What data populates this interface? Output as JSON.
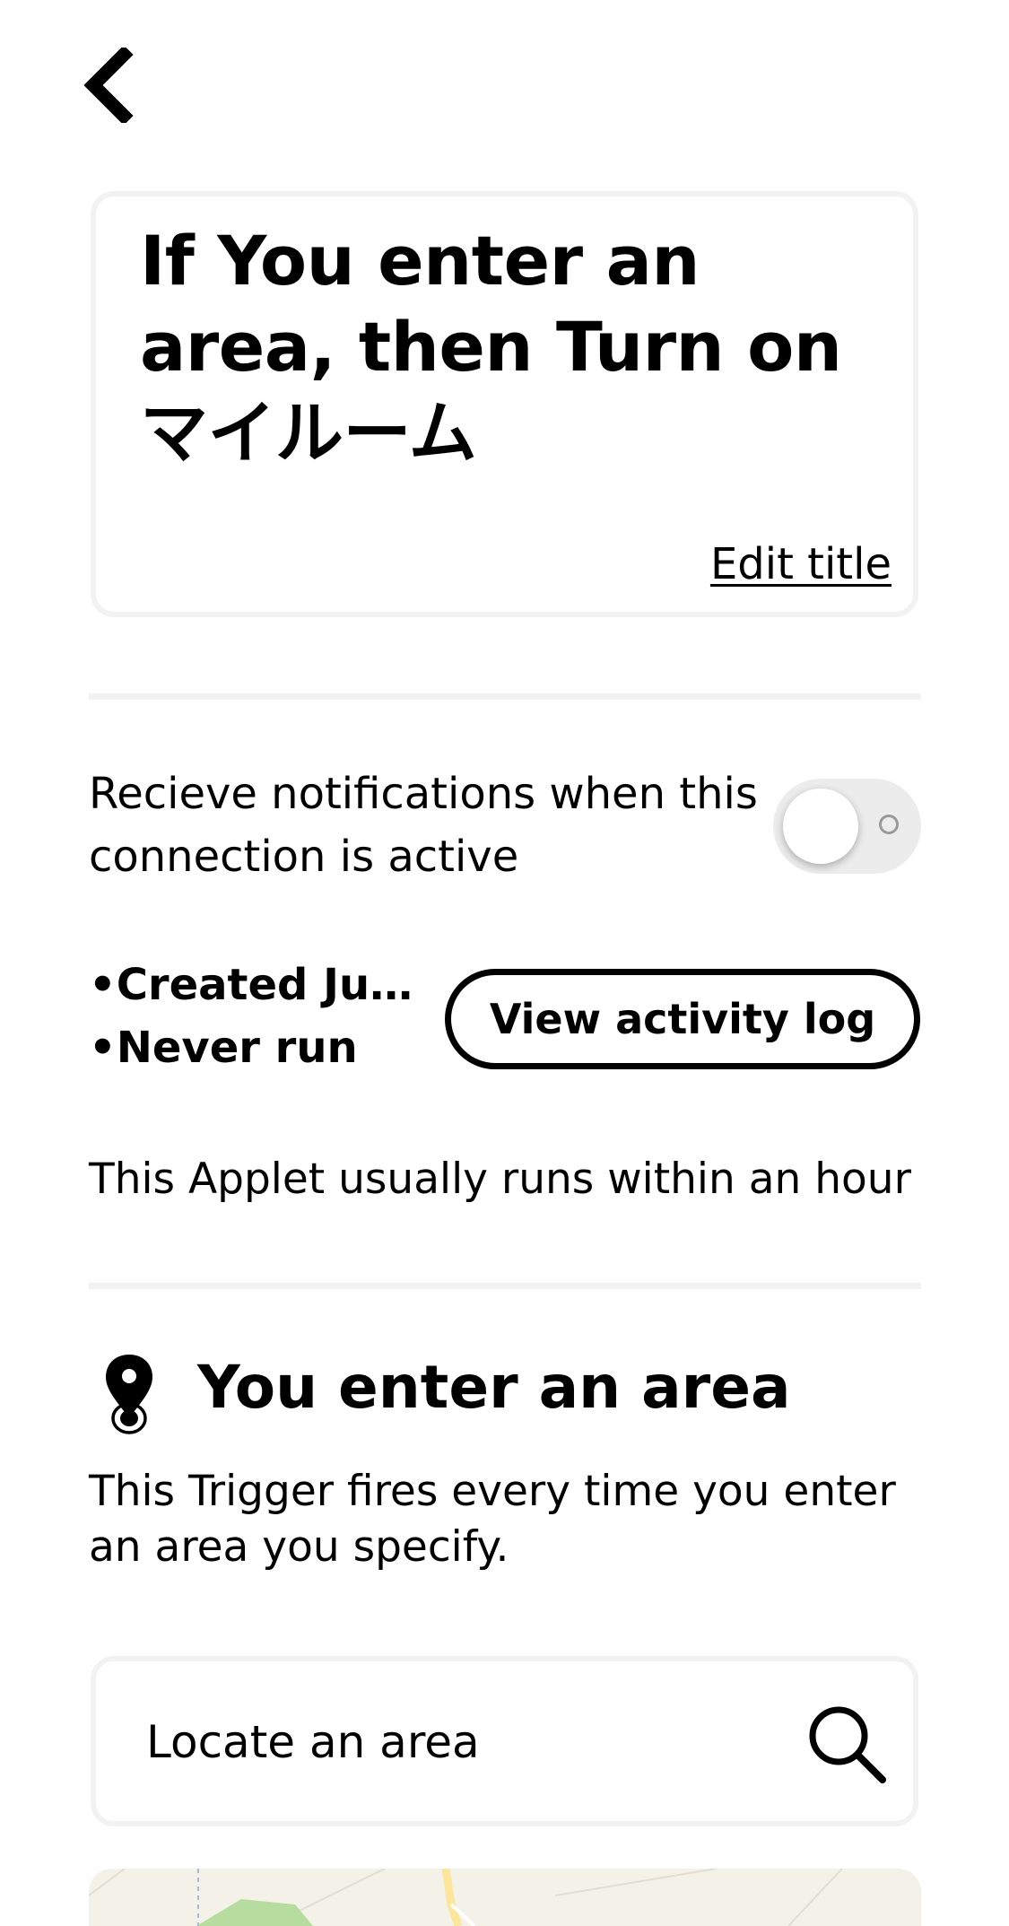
{
  "header": {
    "back_icon": "chevron-left-icon"
  },
  "title_card": {
    "title": "If You enter an area, then Turn on マイルーム",
    "edit_label": "Edit title"
  },
  "notifications": {
    "label": "Recieve notifications when this connection is active",
    "enabled": false
  },
  "meta": {
    "items": [
      "Created Jul…",
      "Never run"
    ],
    "activity_button_label": "View activity log"
  },
  "speed_text": "This Applet usually runs within an hour",
  "trigger": {
    "icon": "location-pin-icon",
    "title": "You enter an area",
    "description": "This Trigger fires every time you enter an area you specify."
  },
  "locate": {
    "label": "Locate an area",
    "search_icon": "search-icon"
  },
  "colors": {
    "text": "#000000",
    "background": "#ffffff",
    "border_light": "#f2f2f2",
    "toggle_off": "#ececec",
    "map_base": "#f4f1e9",
    "map_green": "#b6dca0",
    "map_road": "#fbe69a"
  }
}
